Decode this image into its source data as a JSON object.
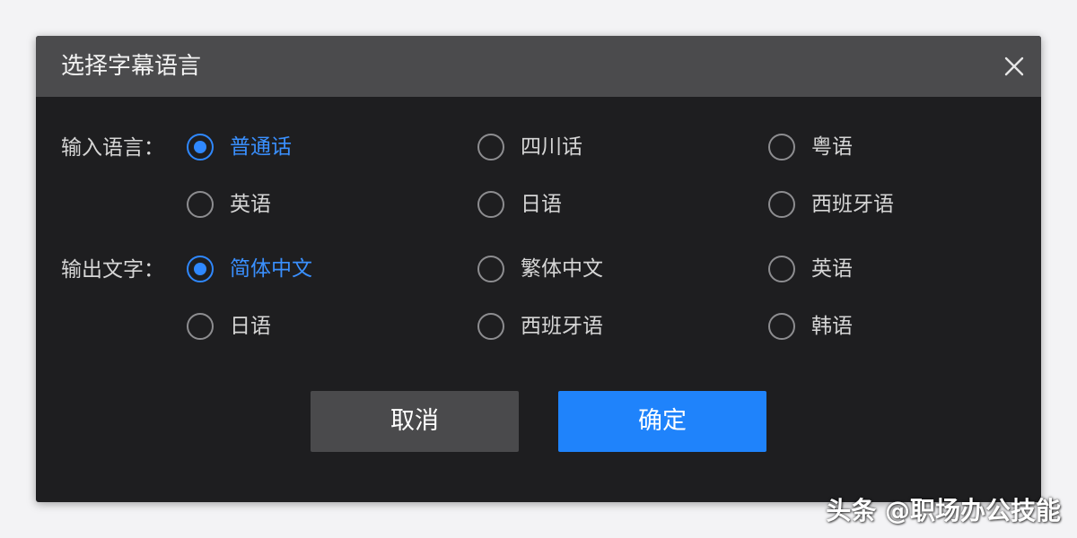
{
  "dialog": {
    "title": "选择字幕语言",
    "close_icon": "close-icon"
  },
  "input_language": {
    "label": "输入语言：",
    "options": [
      {
        "label": "普通话",
        "checked": true
      },
      {
        "label": "四川话",
        "checked": false
      },
      {
        "label": "粤语",
        "checked": false
      },
      {
        "label": "英语",
        "checked": false
      },
      {
        "label": "日语",
        "checked": false
      },
      {
        "label": "西班牙语",
        "checked": false
      }
    ]
  },
  "output_text": {
    "label": "输出文字：",
    "options": [
      {
        "label": "简体中文",
        "checked": true
      },
      {
        "label": "繁体中文",
        "checked": false
      },
      {
        "label": "英语",
        "checked": false
      },
      {
        "label": "日语",
        "checked": false
      },
      {
        "label": "西班牙语",
        "checked": false
      },
      {
        "label": "韩语",
        "checked": false
      }
    ]
  },
  "buttons": {
    "cancel": "取消",
    "confirm": "确定"
  },
  "watermark": "头条 @职场办公技能",
  "colors": {
    "accent": "#1f83fb",
    "selected_text": "#3a90ff",
    "dialog_bg": "#1e1e20",
    "titlebar_bg": "#4b4b4d",
    "cancel_bg": "#4a4a4c"
  }
}
